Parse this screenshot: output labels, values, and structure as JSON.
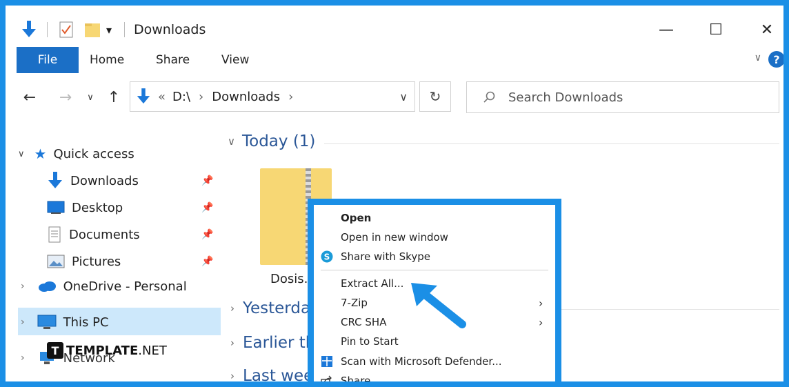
{
  "window": {
    "title": "Downloads",
    "minimize_glyph": "—",
    "maximize_glyph": "☐",
    "close_glyph": "✕"
  },
  "ribbon": {
    "tabs": [
      {
        "label": "File"
      },
      {
        "label": "Home"
      },
      {
        "label": "Share"
      },
      {
        "label": "View"
      }
    ],
    "help_glyph": "?"
  },
  "address": {
    "prefix": "«",
    "segments": [
      "D:\\",
      "Downloads"
    ],
    "separator": "›"
  },
  "search": {
    "placeholder": "Search Downloads"
  },
  "sidebar": {
    "quick_access": "Quick access",
    "pinned": [
      {
        "label": "Downloads",
        "icon": "download-icon"
      },
      {
        "label": "Desktop",
        "icon": "desktop-icon"
      },
      {
        "label": "Documents",
        "icon": "document-icon"
      },
      {
        "label": "Pictures",
        "icon": "pictures-icon"
      }
    ],
    "onedrive": "OneDrive - Personal",
    "this_pc": "This PC",
    "network": "Network"
  },
  "content": {
    "groups": [
      {
        "label": "Today (1)",
        "expanded": true
      },
      {
        "label": "Yesterda",
        "expanded": false
      },
      {
        "label": "Earlier th",
        "expanded": false
      },
      {
        "label": "Last wee",
        "expanded": false
      }
    ],
    "file": {
      "name": "Dosis.."
    }
  },
  "context_menu": {
    "items": [
      {
        "label": "Open",
        "bold": true
      },
      {
        "label": "Open in new window"
      },
      {
        "label": "Share with Skype",
        "icon": "skype-icon"
      },
      {
        "label": "Extract All..."
      },
      {
        "label": "7-Zip",
        "submenu": true
      },
      {
        "label": "CRC SHA",
        "submenu": true
      },
      {
        "label": "Pin to Start"
      },
      {
        "label": "Scan with Microsoft Defender...",
        "icon": "defender-icon"
      },
      {
        "label": "Share",
        "icon": "share-icon"
      }
    ]
  },
  "watermark": {
    "logo_letter": "T",
    "brand": "TEMPLATE",
    "suffix": ".NET"
  },
  "colors": {
    "accent": "#1b8fe6",
    "file_tab": "#1b6fc6",
    "selection": "#cde8fb",
    "group_text": "#2b5797"
  }
}
